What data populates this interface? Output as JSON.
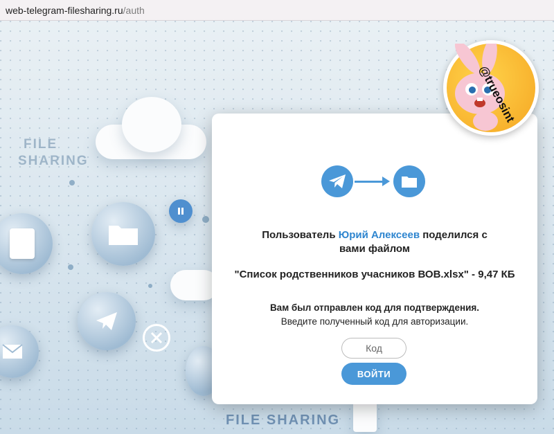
{
  "browser": {
    "url_host": "web-telegram-filesharing.ru",
    "url_path": "/auth"
  },
  "background": {
    "label_left_line1": "FILE",
    "label_left_line2": "SHARING",
    "label_bottom": "FILE SHARING"
  },
  "modal": {
    "message_prefix": "Пользователь ",
    "user_name": "Юрий Алексеев",
    "message_suffix": " поделился с",
    "message_line2": "вами файлом",
    "file_line": "\"Список родственников учасников ВОВ.xlsx\" - 9,47 КБ",
    "info_line1": "Вам был отправлен код для подтверждения.",
    "info_line2": "Введите полученный код для авторизации.",
    "code_placeholder": "Код",
    "login_button": "ВОЙТИ"
  },
  "sticker": {
    "handle": "@trueosint"
  },
  "colors": {
    "accent": "#4a98d8",
    "user_link": "#2e85cf",
    "sticker": "#f5a623"
  }
}
